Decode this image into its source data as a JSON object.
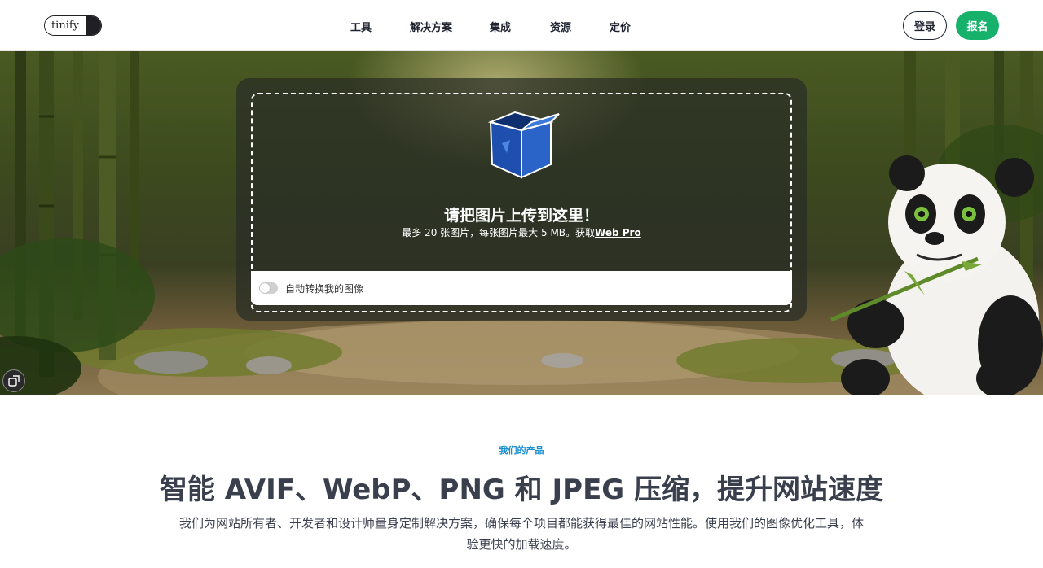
{
  "header": {
    "logo_text": "tinify",
    "nav": [
      "工具",
      "解决方案",
      "集成",
      "资源",
      "定价"
    ],
    "login_label": "登录",
    "signup_label": "报名"
  },
  "upload": {
    "title": "请把图片上传到这里！",
    "subtitle_prefix": "最多 20 张图片，每张图片最大 5 MB。获取",
    "subtitle_link": "Web Pro",
    "convert_label": "自动转换我的图像",
    "convert_enabled": false
  },
  "product": {
    "eyebrow": "我们的产品",
    "headline": "智能 AVIF、WebP、PNG 和 JPEG 压缩，提升网站速度",
    "description": "我们为网站所有者、开发者和设计师量身定制解决方案，确保每个项目都能获得最佳的网站性能。使用我们的图像优化工具，体验更快的加载速度。"
  },
  "colors": {
    "accent_green": "#16b26b",
    "eyebrow_blue": "#1a8fd0",
    "box_blue": "#2a5fc4"
  },
  "icons": [
    "box-icon",
    "feedback-icon"
  ]
}
